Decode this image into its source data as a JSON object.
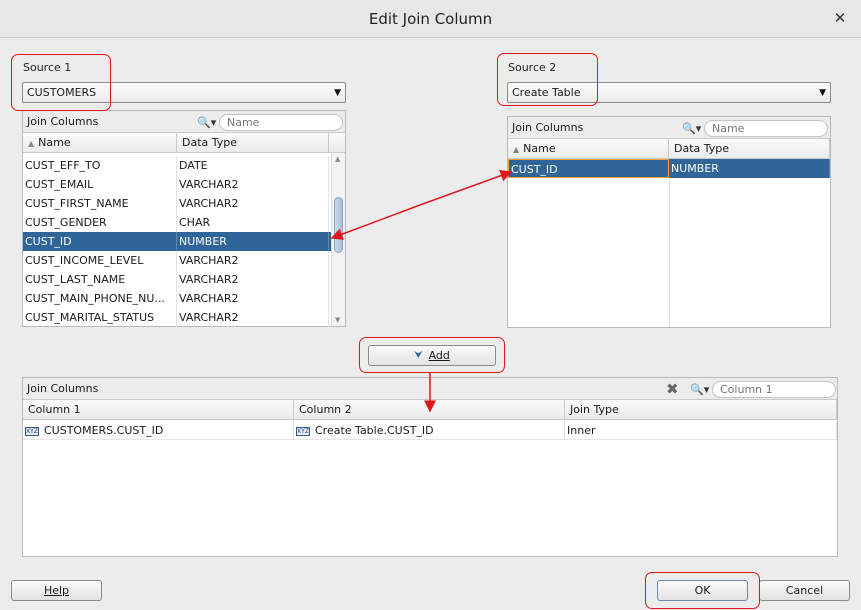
{
  "dialog": {
    "title": "Edit Join Column",
    "close_glyph": "✕"
  },
  "source1": {
    "label": "Source 1",
    "value": "CUSTOMERS",
    "panel_title": "Join Columns",
    "search_placeholder": "Name",
    "columns": [
      "Name",
      "Data Type"
    ],
    "rows": [
      [
        "CUST_EFF_TO",
        "DATE"
      ],
      [
        "CUST_EMAIL",
        "VARCHAR2"
      ],
      [
        "CUST_FIRST_NAME",
        "VARCHAR2"
      ],
      [
        "CUST_GENDER",
        "CHAR"
      ],
      [
        "CUST_ID",
        "NUMBER"
      ],
      [
        "CUST_INCOME_LEVEL",
        "VARCHAR2"
      ],
      [
        "CUST_LAST_NAME",
        "VARCHAR2"
      ],
      [
        "CUST_MAIN_PHONE_NU...",
        "VARCHAR2"
      ],
      [
        "CUST_MARITAL_STATUS",
        "VARCHAR2"
      ]
    ],
    "selected_index": 4
  },
  "source2": {
    "label": "Source 2",
    "value": "Create Table",
    "panel_title": "Join Columns",
    "search_placeholder": "Name",
    "columns": [
      "Name",
      "Data Type"
    ],
    "rows": [
      [
        "CUST_ID",
        "NUMBER"
      ]
    ],
    "selected_index": 0
  },
  "add_button": {
    "label": "Add"
  },
  "joins": {
    "panel_title": "Join Columns",
    "search_placeholder": "Column 1",
    "columns": [
      "Column 1",
      "Column 2",
      "Join Type"
    ],
    "rows": [
      [
        "CUSTOMERS.CUST_ID",
        "Create Table.CUST_ID",
        "Inner"
      ]
    ],
    "type_icon_text": "XYZ"
  },
  "footer": {
    "help": "Help",
    "ok": "OK",
    "cancel": "Cancel"
  },
  "icons": {
    "search": "magnifier-dropdown-icon",
    "delete": "delete-x-icon",
    "sort": "sort-ascending-icon",
    "combo": "dropdown-arrow-icon"
  },
  "colors": {
    "selection": "#2f6598",
    "annotation": "#e0161b"
  }
}
